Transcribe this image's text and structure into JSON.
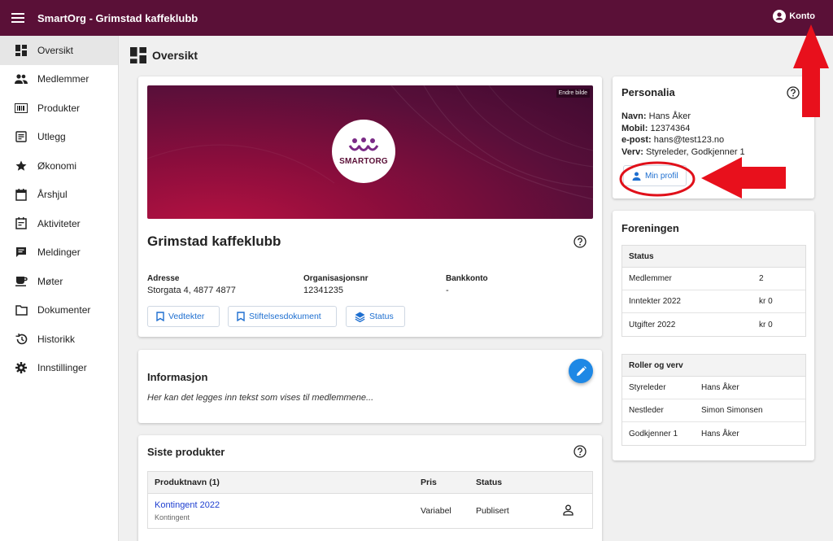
{
  "app": {
    "title": "SmartOrg - Grimstad kaffeklubb",
    "account_label": "Konto",
    "accent_color": "#5a1037",
    "link_color": "#1e6fd0"
  },
  "sidebar": {
    "items": [
      {
        "label": "Oversikt",
        "icon": "dashboard-icon",
        "active": true
      },
      {
        "label": "Medlemmer",
        "icon": "people-icon"
      },
      {
        "label": "Produkter",
        "icon": "barcode-icon"
      },
      {
        "label": "Utlegg",
        "icon": "receipt-icon"
      },
      {
        "label": "Økonomi",
        "icon": "star-icon"
      },
      {
        "label": "Årshjul",
        "icon": "calendar-icon"
      },
      {
        "label": "Aktiviteter",
        "icon": "event-icon"
      },
      {
        "label": "Meldinger",
        "icon": "chat-icon"
      },
      {
        "label": "Møter",
        "icon": "coffee-icon"
      },
      {
        "label": "Dokumenter",
        "icon": "folder-icon"
      },
      {
        "label": "Historikk",
        "icon": "history-icon"
      },
      {
        "label": "Innstillinger",
        "icon": "gear-icon"
      }
    ]
  },
  "page": {
    "title": "Oversikt"
  },
  "org": {
    "change_image": "Endre bilde",
    "logo_text": "SMARTORG",
    "name": "Grimstad kaffeklubb",
    "address_label": "Adresse",
    "address": "Storgata 4, 4877 4877",
    "orgnr_label": "Organisasjonsnr",
    "orgnr": "12341235",
    "bank_label": "Bankkonto",
    "bank": "-",
    "buttons": {
      "vedtekter": "Vedtekter",
      "stiftelse": "Stiftelsesdokument",
      "status": "Status"
    }
  },
  "informasjon": {
    "title": "Informasjon",
    "text": "Her kan det legges inn tekst som vises til medlemmene..."
  },
  "products": {
    "title": "Siste produkter",
    "headers": {
      "name": "Produktnavn (1)",
      "price": "Pris",
      "status": "Status"
    },
    "rows": [
      {
        "name": "Kontingent 2022",
        "sub": "Kontingent",
        "price": "Variabel",
        "status": "Publisert"
      }
    ]
  },
  "personalia": {
    "title": "Personalia",
    "name_label": "Navn:",
    "name": "Hans Åker",
    "mobile_label": "Mobil:",
    "mobile": "12374364",
    "email_label": "e-post:",
    "email": "hans@test123.no",
    "role_label": "Verv:",
    "role": "Styreleder, Godkjenner 1",
    "profile_button": "Min profil"
  },
  "foreningen": {
    "title": "Foreningen",
    "status_header": "Status",
    "status_rows": [
      {
        "label": "Medlemmer",
        "value": "2"
      },
      {
        "label": "Inntekter 2022",
        "value": "kr 0"
      },
      {
        "label": "Utgifter 2022",
        "value": "kr 0"
      }
    ],
    "roles_header": "Roller og verv",
    "roles_rows": [
      {
        "label": "Styreleder",
        "value": "Hans Åker"
      },
      {
        "label": "Nestleder",
        "value": "Simon Simonsen"
      },
      {
        "label": "Godkjenner 1",
        "value": "Hans Åker"
      }
    ]
  }
}
